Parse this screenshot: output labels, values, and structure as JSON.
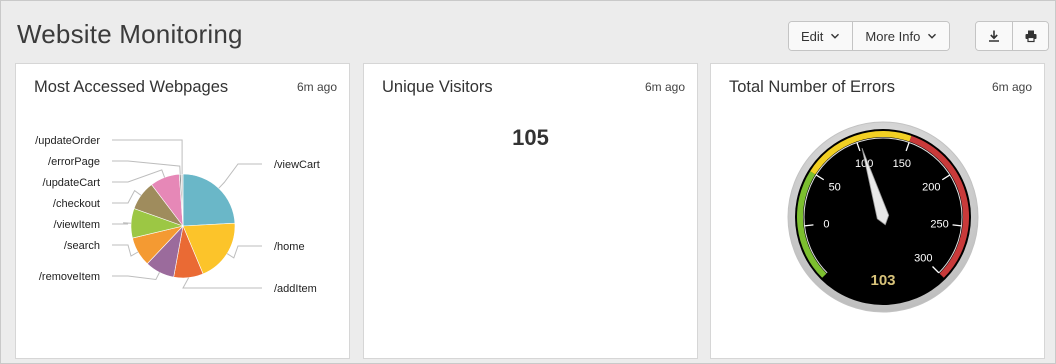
{
  "header": {
    "title": "Website Monitoring",
    "edit_label": "Edit",
    "more_info_label": "More Info",
    "download_icon": "download-icon",
    "print_icon": "print-icon"
  },
  "panels": [
    {
      "title": "Most Accessed Webpages",
      "time": "6m ago"
    },
    {
      "title": "Unique Visitors",
      "time": "6m ago",
      "value": "105"
    },
    {
      "title": "Total Number of Errors",
      "time": "6m ago",
      "value": "103"
    }
  ],
  "chart_data": [
    {
      "type": "pie",
      "categories": [
        "/viewCart",
        "/home",
        "/addItem",
        "/removeItem",
        "/search",
        "/viewItem",
        "/checkout",
        "/updateCart",
        "/errorPage",
        "/updateOrder"
      ],
      "values": [
        21,
        17,
        8,
        8,
        8,
        8,
        8,
        8,
        0.5,
        0.5
      ],
      "colors": [
        "#6ab7c8",
        "#fcc42a",
        "#ea6a34",
        "#9b6b9c",
        "#f49a32",
        "#9cc744",
        "#9f8c5d",
        "#e688b7",
        "#999999",
        "#cccccc"
      ]
    },
    {
      "type": "gauge",
      "value": 103,
      "ticks": [
        0,
        50,
        100,
        150,
        200,
        250,
        300
      ],
      "range": [
        -50,
        300
      ],
      "bands": [
        {
          "from": -50,
          "to": 50,
          "color": "#7cbf2f"
        },
        {
          "from": 50,
          "to": 150,
          "color": "#f2d023"
        },
        {
          "from": 150,
          "to": 300,
          "color": "#c93a3a"
        }
      ]
    }
  ]
}
